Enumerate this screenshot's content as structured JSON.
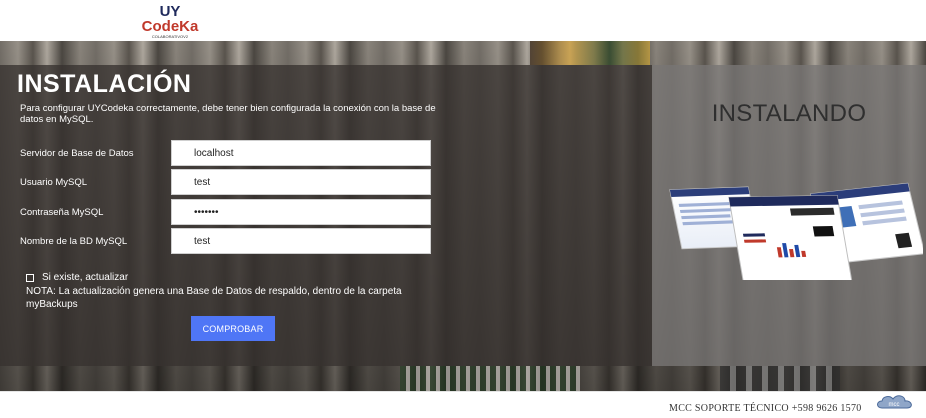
{
  "header": {
    "logo": {
      "line1": "UY",
      "line2": "CodeKa",
      "line3": "COLABORATIVOV2"
    }
  },
  "form": {
    "title": "INSTALACIÓN",
    "intro": "Para configurar UYCodeka correctamente, debe tener bien configurada la conexión con la base de datos en MySQL.",
    "fields": [
      {
        "label": "Servidor de Base de Datos",
        "value": "localhost"
      },
      {
        "label": "Usuario MySQL",
        "value": "test"
      },
      {
        "label": "Contraseña MySQL",
        "value": "•••••••"
      },
      {
        "label": "Nombre de la BD MySQL",
        "value": "test"
      }
    ],
    "checkbox_label": "Si existe, actualizar",
    "note": "NOTA: La actualización genera una Base de Datos de respaldo, dentro de la carpeta myBackups",
    "submit_label": "COMPROBAR"
  },
  "side": {
    "title": "INSTALANDO"
  },
  "footer": {
    "text": "MCC SOPORTE TÉCNICO  +598 9626 1570",
    "logo_text": "mcc"
  },
  "colors": {
    "accent": "#4f76f6",
    "brand_red": "#c0392b",
    "brand_navy": "#1f2a5c"
  }
}
